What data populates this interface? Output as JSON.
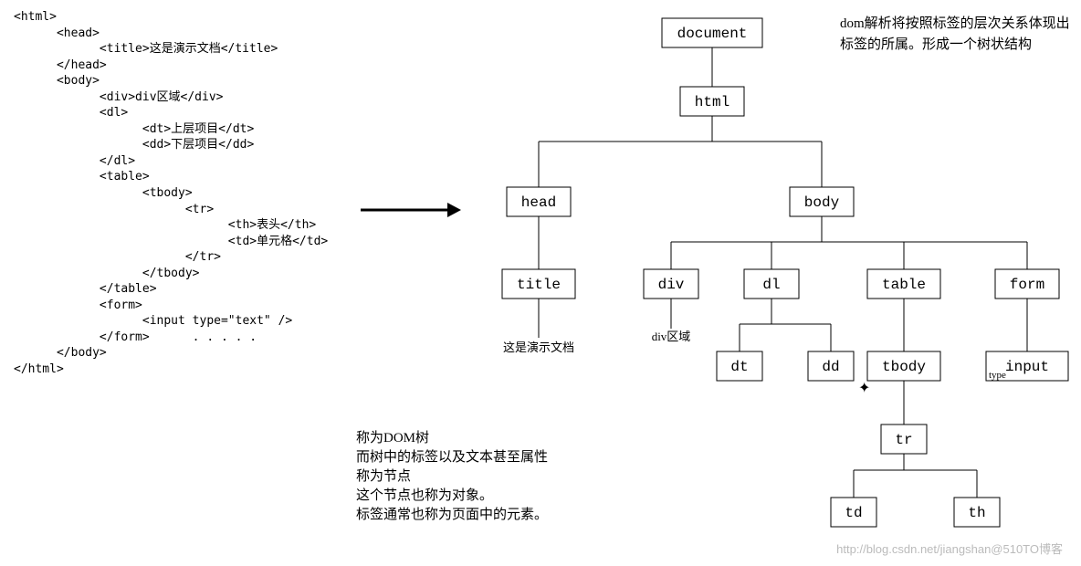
{
  "code": {
    "l1": "<html>",
    "l2": "      <head>",
    "l3": "            <title>这是演示文档</title>",
    "l4": "      </head>",
    "l5": "      <body>",
    "l6": "            <div>div区域</div>",
    "l7": "            <dl>",
    "l8": "                  <dt>上层项目</dt>",
    "l9": "                  <dd>下层项目</dd>",
    "l10": "            </dl>",
    "l11": "            <table>",
    "l12": "                  <tbody>",
    "l13": "                        <tr>",
    "l14": "                              <th>表头</th>",
    "l15": "                              <td>单元格</td>",
    "l16": "                        </tr>",
    "l17": "                  </tbody>",
    "l18": "            </table>",
    "l19": "            <form>",
    "l20": "                  <input type=\"text\" />",
    "l21": "            </form>      . . . . .",
    "l22": "      </body>",
    "l23": "</html>"
  },
  "nodes": {
    "document": "document",
    "html": "html",
    "head": "head",
    "body": "body",
    "title": "title",
    "div": "div",
    "dl": "dl",
    "table": "table",
    "form": "form",
    "dt": "dt",
    "dd": "dd",
    "tbody": "tbody",
    "input": "input",
    "tr": "tr",
    "td": "td",
    "th": "th"
  },
  "leaves": {
    "title_text": "这是演示文档",
    "div_text": "div区域",
    "input_attr": "type"
  },
  "annotations": {
    "top_right": "dom解析将按照标签的层次关系体现出标签的所属。形成一个树状结构",
    "bottom_1": "称为DOM树",
    "bottom_2": "而树中的标签以及文本甚至属性称为节点",
    "bottom_3": "这个节点也称为对象。",
    "bottom_4": "标签通常也称为页面中的元素。"
  },
  "watermark": "http://blog.csdn.net/jiangshan@510TO博客"
}
